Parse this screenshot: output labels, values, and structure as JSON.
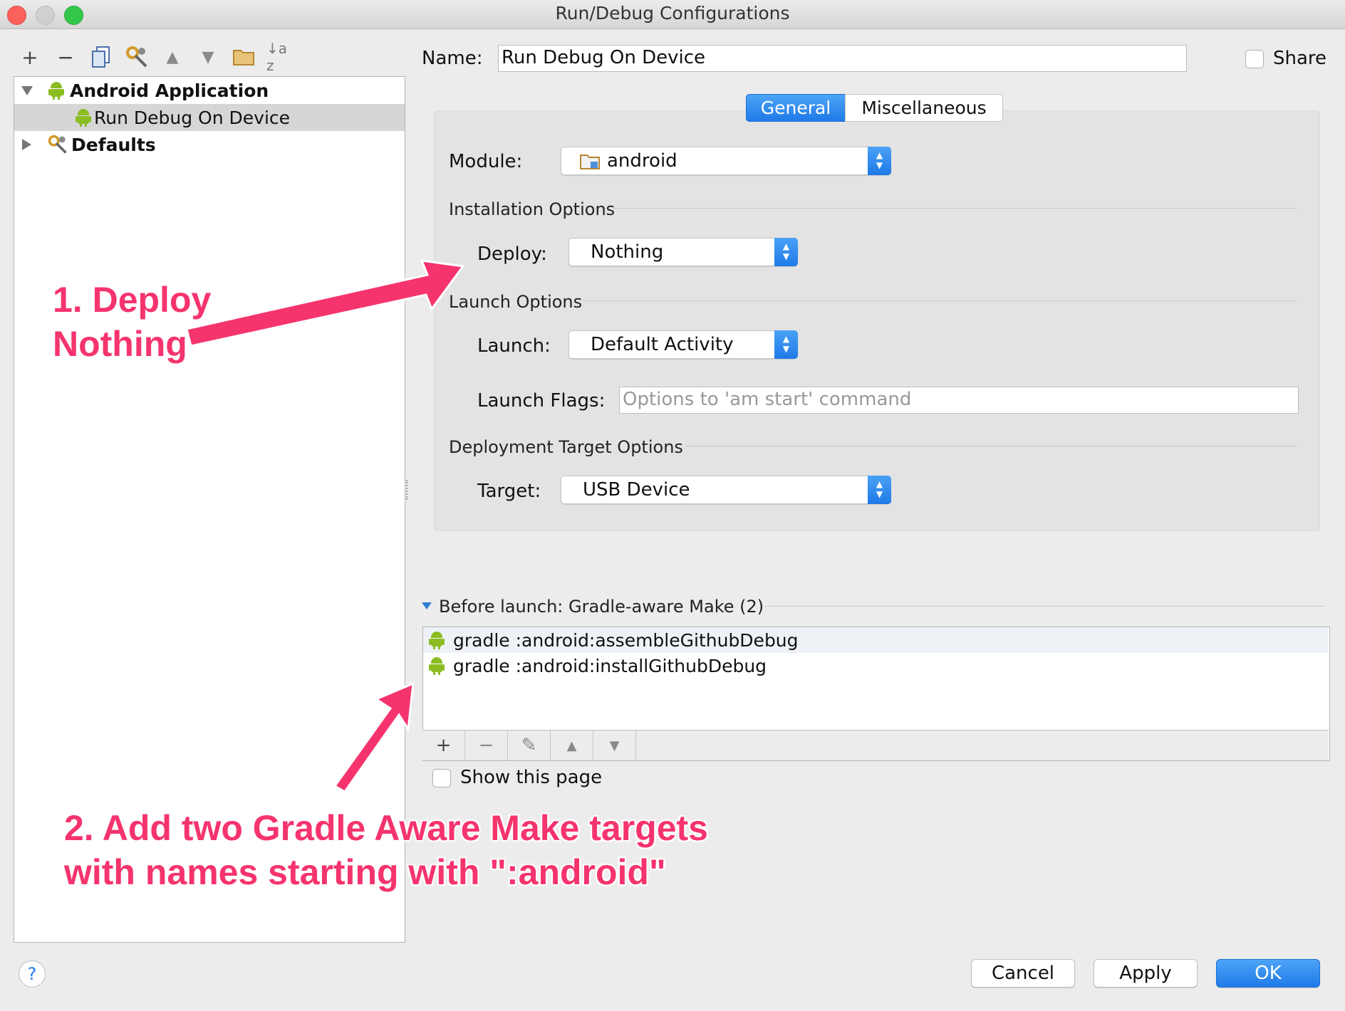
{
  "window": {
    "title": "Run/Debug Configurations"
  },
  "toolbar": {
    "icons": [
      "add-icon",
      "remove-icon",
      "copy-icon",
      "edit-defaults-icon",
      "move-up-icon",
      "move-down-icon",
      "folder-icon",
      "sort-icon"
    ],
    "sort_glyph": "↓a z"
  },
  "tree": {
    "items": [
      {
        "label": "Android Application",
        "bold": true,
        "expanded": true
      },
      {
        "label": "Run Debug On Device",
        "bold": false,
        "selected": true
      },
      {
        "label": "Defaults",
        "bold": true,
        "expanded": false
      }
    ]
  },
  "form": {
    "name_label": "Name:",
    "name_value": "Run Debug On Device",
    "share_label": "Share",
    "tabs": [
      "General",
      "Miscellaneous"
    ],
    "active_tab": "General",
    "module_label": "Module:",
    "module_value": "android",
    "installation_section": "Installation Options",
    "deploy_label": "Deploy:",
    "deploy_value": "Nothing",
    "launch_section": "Launch Options",
    "launch_label": "Launch:",
    "launch_value": "Default Activity",
    "flags_label": "Launch Flags:",
    "flags_placeholder": "Options to 'am start' command",
    "deployment_section": "Deployment Target Options",
    "target_label": "Target:",
    "target_value": "USB Device"
  },
  "before_launch": {
    "header": "Before launch: Gradle-aware Make (2)",
    "items": [
      "gradle :android:assembleGithubDebug",
      "gradle :android:installGithubDebug"
    ],
    "buttons": {
      "add": "+",
      "remove": "−",
      "edit": "✎",
      "up": "▲",
      "down": "▼"
    },
    "show_page_label": "Show this page"
  },
  "footer": {
    "help": "?",
    "cancel": "Cancel",
    "apply": "Apply",
    "ok": "OK"
  },
  "annotations": {
    "step1_line1": "1. Deploy",
    "step1_line2": "Nothing",
    "step2_line1": "2. Add two Gradle Aware Make targets",
    "step2_line2": "with names starting with \":android\""
  },
  "colors": {
    "accent": "#1f7ae8",
    "annotation": "#f5346e",
    "android_green": "#8bbd23"
  }
}
